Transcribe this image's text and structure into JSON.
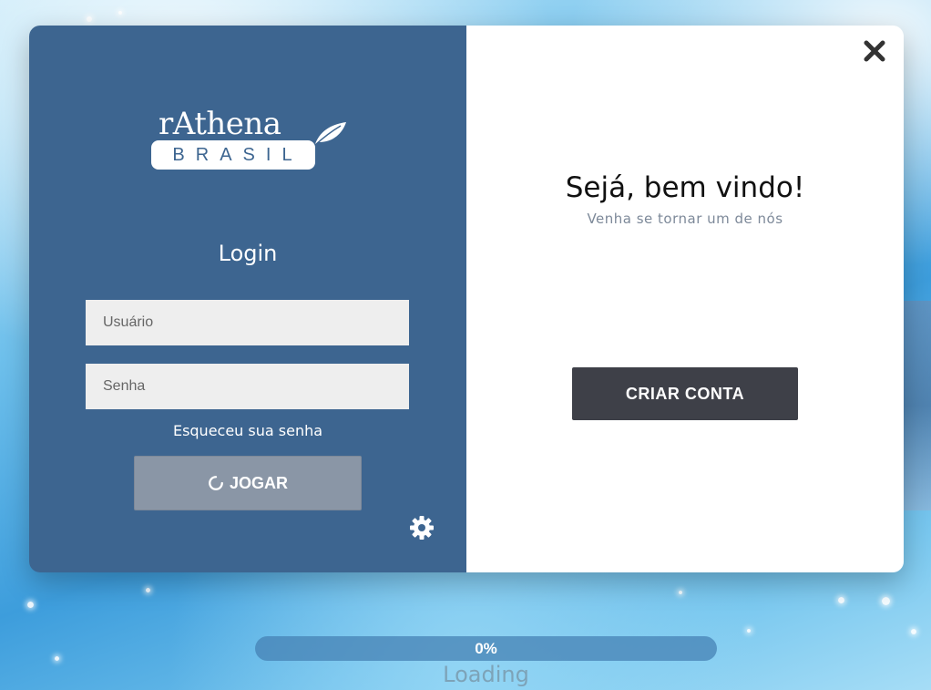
{
  "logo": {
    "top_text": "rAthena",
    "badge_text": "BRASIL"
  },
  "login": {
    "title": "Login",
    "username_placeholder": "Usuário",
    "password_placeholder": "Senha",
    "forgot_label": "Esqueceu sua senha",
    "play_label": "JOGAR",
    "play_icon": "loading-spinner-icon",
    "settings_icon": "gear-icon"
  },
  "welcome": {
    "title": "Sejá, bem vindo!",
    "subtitle": "Venha se tornar um de nós",
    "create_label": "CRIAR CONTA",
    "close_icon": "close-icon"
  },
  "loader": {
    "progress_percent": 0,
    "progress_text": "0%",
    "status_text": "Loading"
  },
  "colors": {
    "left_panel": "#3d6590",
    "play_button": "#8a96a6",
    "create_button": "#3e4048",
    "subtitle": "#7d8999"
  }
}
